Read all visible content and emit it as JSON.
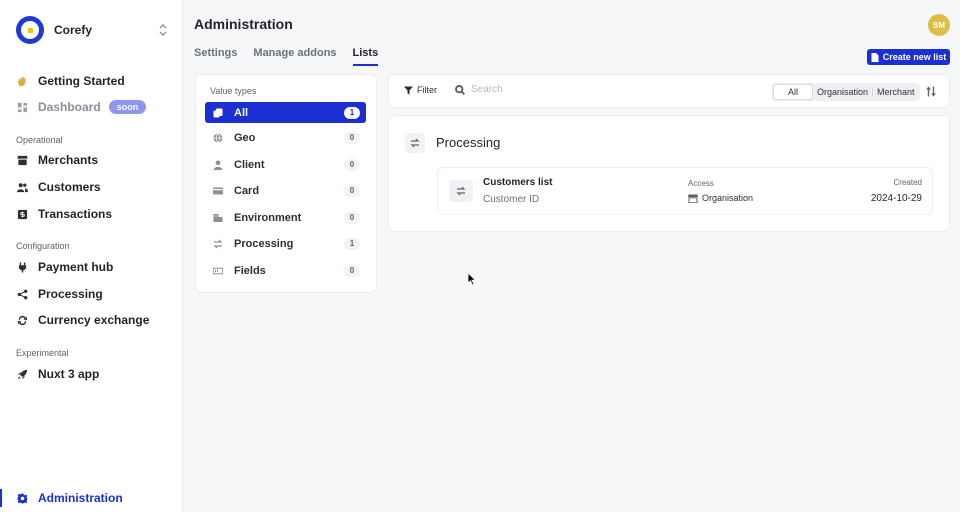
{
  "sidebar": {
    "org_name": "Corefy",
    "items_top": [
      {
        "label": "Getting Started",
        "icon": "wave-hand-icon"
      },
      {
        "label": "Dashboard",
        "icon": "dashboard-icon",
        "badge": "soon"
      }
    ],
    "sections": [
      {
        "title": "Operational",
        "items": [
          {
            "label": "Merchants",
            "icon": "store-icon"
          },
          {
            "label": "Customers",
            "icon": "users-icon"
          },
          {
            "label": "Transactions",
            "icon": "dollar-icon"
          }
        ]
      },
      {
        "title": "Configuration",
        "items": [
          {
            "label": "Payment hub",
            "icon": "plug-icon"
          },
          {
            "label": "Processing",
            "icon": "share-nodes-icon"
          },
          {
            "label": "Currency exchange",
            "icon": "exchange-icon"
          }
        ]
      },
      {
        "title": "Experimental",
        "items": [
          {
            "label": "Nuxt 3 app",
            "icon": "rocket-icon"
          }
        ]
      }
    ],
    "bottom_item": {
      "label": "Administration",
      "icon": "gear-icon"
    }
  },
  "header": {
    "title": "Administration",
    "avatar_initials": "SM",
    "tabs": [
      "Settings",
      "Manage addons",
      "Lists"
    ],
    "active_tab": "Lists",
    "create_button": "Create new list"
  },
  "value_types": {
    "title": "Value types",
    "items": [
      {
        "label": "All",
        "count": "1",
        "icon": "copy-icon"
      },
      {
        "label": "Geo",
        "count": "0",
        "icon": "globe-icon"
      },
      {
        "label": "Client",
        "count": "0",
        "icon": "person-icon"
      },
      {
        "label": "Card",
        "count": "0",
        "icon": "credit-card-icon"
      },
      {
        "label": "Environment",
        "count": "0",
        "icon": "server-icon"
      },
      {
        "label": "Processing",
        "count": "1",
        "icon": "arrows-exchange-icon"
      },
      {
        "label": "Fields",
        "count": "0",
        "icon": "input-field-icon"
      }
    ]
  },
  "filter_bar": {
    "filter_label": "Filter",
    "search_placeholder": "Search",
    "scope_options": [
      "All",
      "Organisation",
      "Merchant"
    ],
    "active_scope": "All"
  },
  "group": {
    "title": "Processing",
    "lists": [
      {
        "name": "Customers list",
        "subtitle": "Customer ID",
        "access_label": "Access",
        "access_value": "Organisation",
        "created_label": "Created",
        "created_value": "2024-10-29"
      }
    ]
  },
  "colors": {
    "accent": "#1c2fd2",
    "badge_soon": "#8d96f0",
    "avatar": "#e2bd44"
  }
}
